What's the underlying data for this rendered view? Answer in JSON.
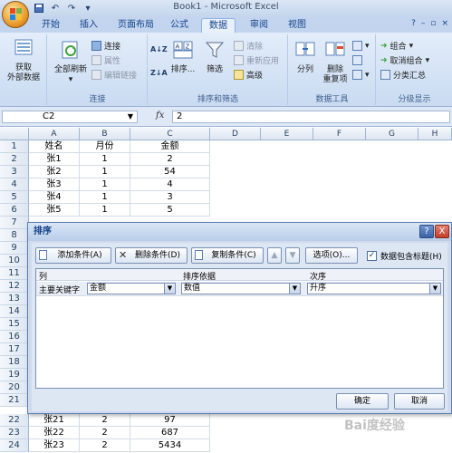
{
  "window": {
    "title": "Book1 - Microsoft Excel"
  },
  "tabs": [
    "开始",
    "插入",
    "页面布局",
    "公式",
    "数据",
    "审阅",
    "视图"
  ],
  "active_tab": "数据",
  "ribbon": {
    "get_external": {
      "line1": "获取",
      "line2": "外部数据"
    },
    "refresh_all": "全部刷新",
    "connections": "连接",
    "properties": "属性",
    "edit_links": "编辑链接",
    "group_connections": "连接",
    "sort_az": "A↓Z",
    "sort_za": "Z↓A",
    "sort": "排序...",
    "filter": "筛选",
    "clear": "清除",
    "reapply": "重新应用",
    "advanced": "高级",
    "group_sort_filter": "排序和筛选",
    "text_to_columns": "分列",
    "remove_duplicates": {
      "line1": "删除",
      "line2": "重复项"
    },
    "group_data_tools": "数据工具",
    "group_btn": "组合",
    "ungroup_btn": "取消组合",
    "subtotal": "分类汇总",
    "group_outline": "分级显示"
  },
  "formula_bar": {
    "name_box": "C2",
    "fx": "fx",
    "value": "2"
  },
  "columns": [
    "A",
    "B",
    "C",
    "D",
    "E",
    "F",
    "G",
    "H"
  ],
  "rows_top": [
    {
      "n": "1",
      "a": "姓名",
      "b": "月份",
      "c": "金额"
    },
    {
      "n": "2",
      "a": "张1",
      "b": "1",
      "c": "2"
    },
    {
      "n": "3",
      "a": "张2",
      "b": "1",
      "c": "54"
    },
    {
      "n": "4",
      "a": "张3",
      "b": "1",
      "c": "4"
    },
    {
      "n": "5",
      "a": "张4",
      "b": "1",
      "c": "3"
    },
    {
      "n": "6",
      "a": "张5",
      "b": "1",
      "c": "5"
    },
    {
      "n": "7",
      "a": "",
      "b": "",
      "c": ""
    }
  ],
  "row_numbers_hidden": [
    "8",
    "9",
    "10",
    "11",
    "12",
    "13",
    "14",
    "15",
    "16",
    "17",
    "18",
    "19",
    "20",
    "21"
  ],
  "rows_bottom": [
    {
      "n": "22",
      "a": "张21",
      "b": "2",
      "c": "97"
    },
    {
      "n": "23",
      "a": "张22",
      "b": "2",
      "c": "687"
    },
    {
      "n": "24",
      "a": "张23",
      "b": "2",
      "c": "5434"
    }
  ],
  "dialog": {
    "title": "排序",
    "help": "?",
    "close": "X",
    "add_level": "添加条件(A)",
    "delete_level": "删除条件(D)",
    "copy_level": "复制条件(C)",
    "options": "选项(O)...",
    "has_headers": "数据包含标题(H)",
    "headers": {
      "column": "列",
      "sort_on": "排序依据",
      "order": "次序"
    },
    "row": {
      "label": "主要关键字",
      "column": "金额",
      "sort_on": "数值",
      "order": "升序"
    },
    "ok": "确定",
    "cancel": "取消"
  },
  "watermark": "Bai度经验"
}
